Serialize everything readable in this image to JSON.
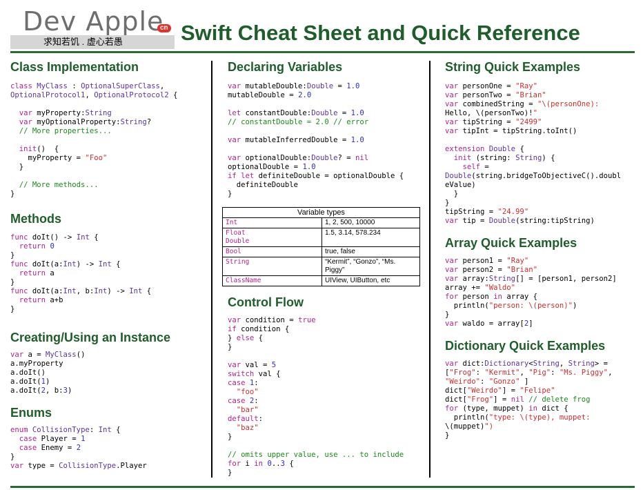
{
  "header": {
    "logo_text": "Dev Apple",
    "logo_badge": "cn",
    "logo_tagline": "求知若饥 . 虚心若愚",
    "title": "Swift Cheat Sheet and Quick Reference"
  },
  "sections": {
    "class_impl": "Class Implementation",
    "methods": "Methods",
    "instance": "Creating/Using an Instance",
    "enums": "Enums",
    "declaring": "Declaring Variables",
    "control": "Control Flow",
    "string": "String Quick Examples",
    "array": "Array Quick Examples",
    "dict": "Dictionary Quick Examples"
  },
  "code": {
    "class_impl": "class MyClass : OptionalSuperClass,\nOptionalProtocol1, OptionalProtocol2 {\n\n  var myProperty:String\n  var myOptionalProperty:String?\n  // More properties...\n\n  init()  {\n    myProperty = \"Foo\"\n  }\n\n  // More methods...\n}",
    "methods": "func doIt() -> Int {\n  return 0\n}\nfunc doIt(a:Int) -> Int {\n  return a\n}\nfunc doIt(a:Int, b:Int) -> Int {\n  return a+b\n}",
    "instance": "var a = MyClass()\na.myProperty\na.doIt()\na.doIt(1)\na.doIt(2, b:3)",
    "enums": "enum CollisionType: Int {\n  case Player = 1\n  case Enemy = 2\n}\nvar type = CollisionType.Player",
    "declaring": "var mutableDouble:Double = 1.0\nmutableDouble = 2.0\n\nlet constantDouble:Double = 1.0\n// constantDouble = 2.0 // error\n\nvar mutableInferredDouble = 1.0\n\nvar optionalDouble:Double? = nil\noptionalDouble = 1.0\nif let definiteDouble = optionalDouble {\n  definiteDouble\n}",
    "control": "var condition = true\nif condition {\n} else {\n}\n\nvar val = 5\nswitch val {\ncase 1:\n  \"foo\"\ncase 2:\n  \"bar\"\ndefault:\n  \"baz\"\n}\n\n// omits upper value, use ... to include\nfor i in 0..3 {\n}",
    "string": "var personOne = \"Ray\"\nvar personTwo = \"Brian\"\nvar combinedString = \"\\(personOne):\nHello, \\(personTwo)!\"\nvar tipString = \"2499\"\nvar tipInt = tipString.toInt()\n\nextension Double {\n  init (string: String) {\n    self =\nDouble(string.bridgeToObjectiveC().doubl\neValue)\n  }\n}\ntipString = \"24.99\"\nvar tip = Double(string:tipString)",
    "array": "var person1 = \"Ray\"\nvar person2 = \"Brian\"\nvar array:String[] = [person1, person2]\narray += \"Waldo\"\nfor person in array {\n  println(\"person: \\(person)\")\n}\nvar waldo = array[2]",
    "dict": "var dict:Dictionary<String, String> =\n[\"Frog\": \"Kermit\", \"Pig\": \"Ms. Piggy\",\n\"Weirdo\": \"Gonzo\" ]\ndict[\"Weirdo\"] = \"Felipe\"\ndict[\"Frog\"] = nil // delete frog\nfor (type, muppet) in dict {\n  println(\"type: \\(type), muppet:\n\\(muppet)\")\n}"
  },
  "variable_types": {
    "caption": "Variable types",
    "rows": [
      {
        "type": "Int",
        "example": "1, 2, 500, 10000"
      },
      {
        "type": "Float\nDouble",
        "example": "1.5, 3.14, 578.234"
      },
      {
        "type": "Bool",
        "example": "true, false"
      },
      {
        "type": "String",
        "example": "“Kermit”, “Gonzo”, “Ms.\nPiggy”"
      },
      {
        "type": "ClassName",
        "example": "UIView, UIButton, etc"
      }
    ]
  },
  "colors": {
    "heading": "#1f5e2b",
    "keyword": "#b3238b",
    "type": "#5b32a8",
    "string": "#d02d2d",
    "number": "#2b2bd6",
    "comment": "#1b8a1b"
  }
}
